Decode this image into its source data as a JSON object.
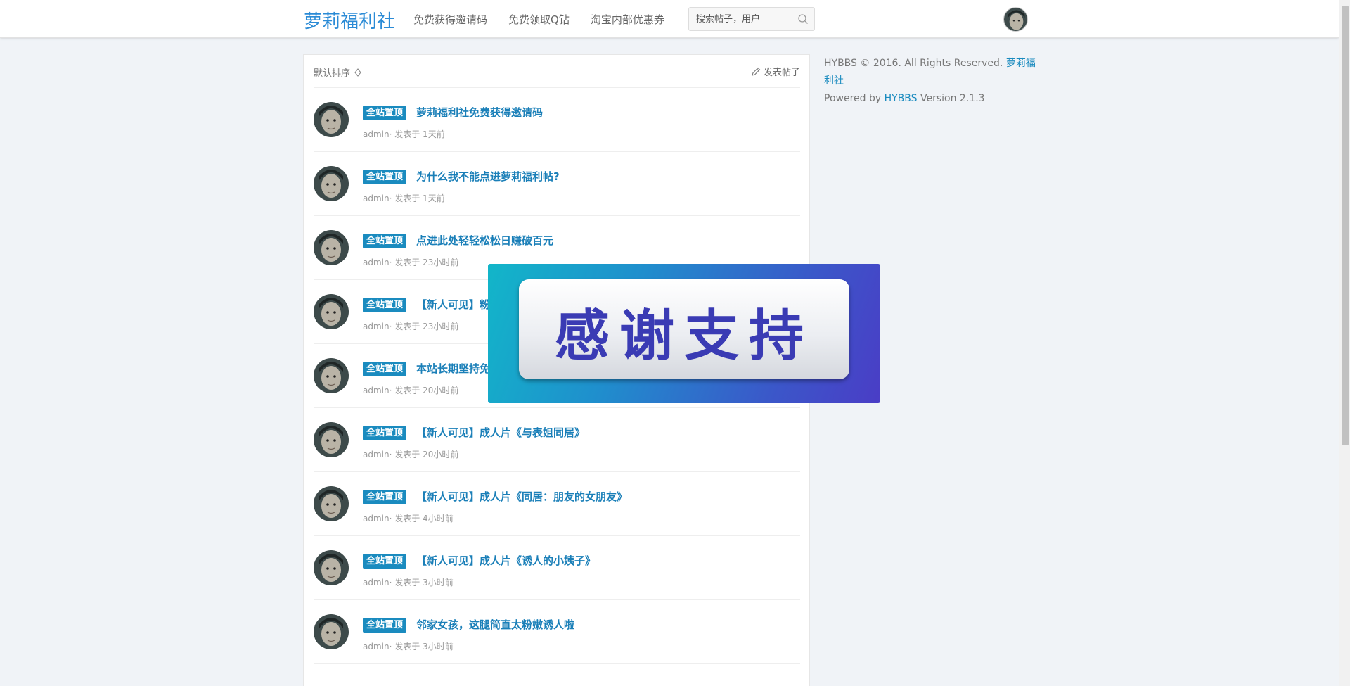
{
  "header": {
    "brand": "萝莉福利社",
    "nav": [
      "免费获得邀请码",
      "免费领取Q钻",
      "淘宝内部优惠券"
    ],
    "search_placeholder": "搜索帖子，用户"
  },
  "panel": {
    "sort_label": "默认排序",
    "post_label": "发表帖子"
  },
  "threads": [
    {
      "badge": "全站置顶",
      "title": "萝莉福利社免费获得邀请码",
      "author": "admin",
      "meta": "· 发表于 1天前"
    },
    {
      "badge": "全站置顶",
      "title": "为什么我不能点进萝莉福利帖?",
      "author": "admin",
      "meta": "· 发表于 1天前"
    },
    {
      "badge": "全站置顶",
      "title": "点进此处轻轻松松日赚破百元",
      "author": "admin",
      "meta": "· 发表于 23小时前"
    },
    {
      "badge": "全站置顶",
      "title": "【新人可见】粉",
      "author": "admin",
      "meta": "· 发表于 23小时前"
    },
    {
      "badge": "全站置顶",
      "title": "本站长期坚持免",
      "author": "admin",
      "meta": "· 发表于 20小时前"
    },
    {
      "badge": "全站置顶",
      "title": "【新人可见】成人片《与表姐同居》",
      "author": "admin",
      "meta": "· 发表于 20小时前"
    },
    {
      "badge": "全站置顶",
      "title": "【新人可见】成人片《同居：朋友的女朋友》",
      "author": "admin",
      "meta": "· 发表于 4小时前"
    },
    {
      "badge": "全站置顶",
      "title": "【新人可见】成人片《诱人的小姨子》",
      "author": "admin",
      "meta": "· 发表于 3小时前"
    },
    {
      "badge": "全站置顶",
      "title": "邻家女孩，这腿简直太粉嫩诱人啦",
      "author": "admin",
      "meta": "· 发表于 3小时前"
    }
  ],
  "sidebar": {
    "copyright": "HYBBS © 2016. All Rights Reserved.",
    "site_link": "萝莉福利社",
    "powered_prefix": "Powered by",
    "powered_link": "HYBBS",
    "version": "Version 2.1.3"
  },
  "overlay": {
    "text": "感谢支持"
  },
  "colors": {
    "brand": "#2b8bd6",
    "badge": "#1a8bbf",
    "title": "#1a7fb8"
  },
  "icons": {
    "search": "search-icon",
    "sort": "sort-icon",
    "post": "pencil-icon"
  }
}
